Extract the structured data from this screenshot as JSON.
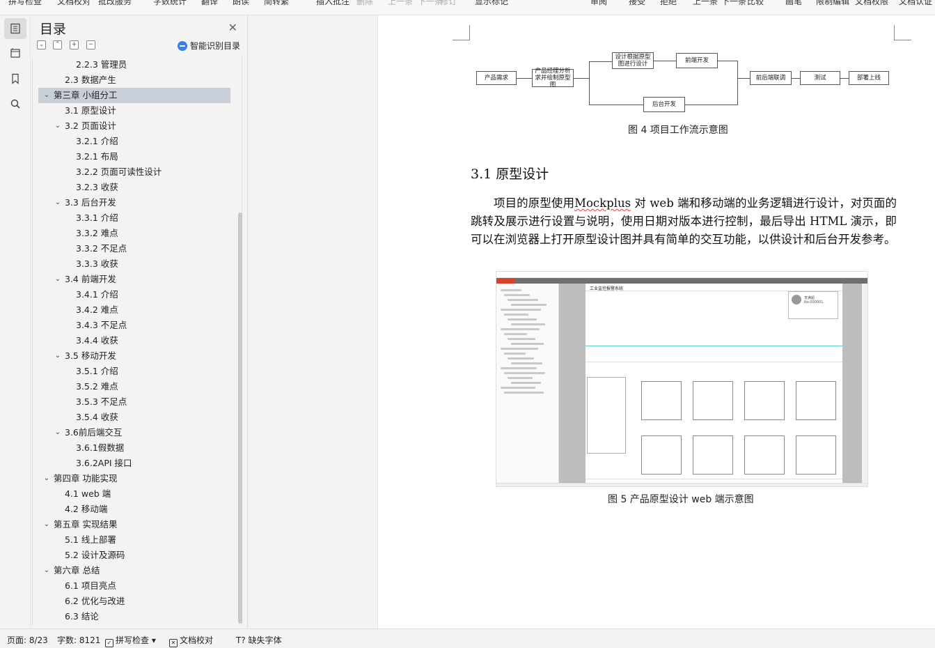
{
  "toolbar": {
    "items": [
      "拼写检查",
      "文档校对",
      "批改服务",
      "字数统计",
      "翻译",
      "朗读",
      "简转繁",
      "插入批注",
      "删除",
      "上一条",
      "下一条",
      "修订",
      "显示标记",
      "审阅",
      "接受",
      "拒绝",
      "上一条",
      "下一条",
      "比较",
      "画笔",
      "限制编辑",
      "文档权限",
      "文档认证"
    ]
  },
  "rail": {
    "icons": [
      "toc-icon",
      "pages-icon",
      "bookmark-icon",
      "search-icon"
    ]
  },
  "toc": {
    "title": "目录",
    "smart_label": "智能识别目录",
    "items": [
      {
        "label": "2.2.3  管理员",
        "level": 3,
        "arrow": ""
      },
      {
        "label": "2.3  数据产生",
        "level": 2,
        "arrow": ""
      },
      {
        "label": "第三章  小组分工",
        "level": 1,
        "arrow": "⌄",
        "selected": true
      },
      {
        "label": "3.1  原型设计",
        "level": 2,
        "arrow": ""
      },
      {
        "label": "3.2  页面设计",
        "level": 2,
        "arrow": "⌄"
      },
      {
        "label": "3.2.1  介绍",
        "level": 3,
        "arrow": ""
      },
      {
        "label": "3.2.1  布局",
        "level": 3,
        "arrow": ""
      },
      {
        "label": "3.2.2  页面可读性设计",
        "level": 3,
        "arrow": ""
      },
      {
        "label": "3.2.3  收获",
        "level": 3,
        "arrow": ""
      },
      {
        "label": "3.3  后台开发",
        "level": 2,
        "arrow": "⌄"
      },
      {
        "label": "3.3.1  介绍",
        "level": 3,
        "arrow": ""
      },
      {
        "label": "3.3.2  难点",
        "level": 3,
        "arrow": ""
      },
      {
        "label": "3.3.2  不足点",
        "level": 3,
        "arrow": ""
      },
      {
        "label": "3.3.3  收获",
        "level": 3,
        "arrow": ""
      },
      {
        "label": "3.4  前端开发",
        "level": 2,
        "arrow": "⌄"
      },
      {
        "label": "3.4.1  介绍",
        "level": 3,
        "arrow": ""
      },
      {
        "label": "3.4.2  难点",
        "level": 3,
        "arrow": ""
      },
      {
        "label": "3.4.3  不足点",
        "level": 3,
        "arrow": ""
      },
      {
        "label": "3.4.4  收获",
        "level": 3,
        "arrow": ""
      },
      {
        "label": "3.5  移动开发",
        "level": 2,
        "arrow": "⌄"
      },
      {
        "label": "3.5.1  介绍",
        "level": 3,
        "arrow": ""
      },
      {
        "label": "3.5.2  难点",
        "level": 3,
        "arrow": ""
      },
      {
        "label": "3.5.3  不足点",
        "level": 3,
        "arrow": ""
      },
      {
        "label": "3.5.4  收获",
        "level": 3,
        "arrow": ""
      },
      {
        "label": "3.6前后端交互",
        "level": 2,
        "arrow": "⌄"
      },
      {
        "label": "3.6.1假数据",
        "level": 3,
        "arrow": ""
      },
      {
        "label": "3.6.2API 接口",
        "level": 3,
        "arrow": ""
      },
      {
        "label": "第四章  功能实现",
        "level": 1,
        "arrow": "⌄"
      },
      {
        "label": "4.1 web 端",
        "level": 2,
        "arrow": ""
      },
      {
        "label": "4.2  移动端",
        "level": 2,
        "arrow": ""
      },
      {
        "label": "第五章  实现结果",
        "level": 1,
        "arrow": "⌄"
      },
      {
        "label": "5.1  线上部署",
        "level": 2,
        "arrow": ""
      },
      {
        "label": "5.2  设计及源码",
        "level": 2,
        "arrow": ""
      },
      {
        "label": "第六章  总结",
        "level": 1,
        "arrow": "⌄"
      },
      {
        "label": "6.1  项目亮点",
        "level": 2,
        "arrow": ""
      },
      {
        "label": "6.2  优化与改进",
        "level": 2,
        "arrow": ""
      },
      {
        "label": "6.3  结论",
        "level": 2,
        "arrow": ""
      }
    ]
  },
  "document": {
    "flow": {
      "nodes": [
        "产品需求",
        "产品经理分析求并绘制原型图",
        "设计根据原型图进行设计",
        "前端开发",
        "后台开发",
        "前后端联调",
        "测试",
        "部署上线"
      ],
      "caption": "图 4  项目工作流示意图"
    },
    "section_title": "3.1  原型设计",
    "paragraph_before": "项目的原型使用",
    "paragraph_tool": "Mockplus",
    "paragraph_after": " 对 web 端和移动端的业务逻辑进行设计，对页面的跳转及展示进行设置与说明，使用日期对版本进行控制，最后导出 HTML 演示，即可以在浏览器上打开原型设计图并具有简单的交互功能，以供设计和后台开发参考。",
    "mockup": {
      "app_title": "工业监控报警系统",
      "user_name": "李满超",
      "user_no": "No.000001"
    },
    "figure_caption": "图 5 产品原型设计 web 端示意图"
  },
  "status": {
    "page": "页面: 8/23",
    "words": "字数: 8121",
    "spell": "拼写检查",
    "proof": "文档校对",
    "font": "缺失字体"
  }
}
